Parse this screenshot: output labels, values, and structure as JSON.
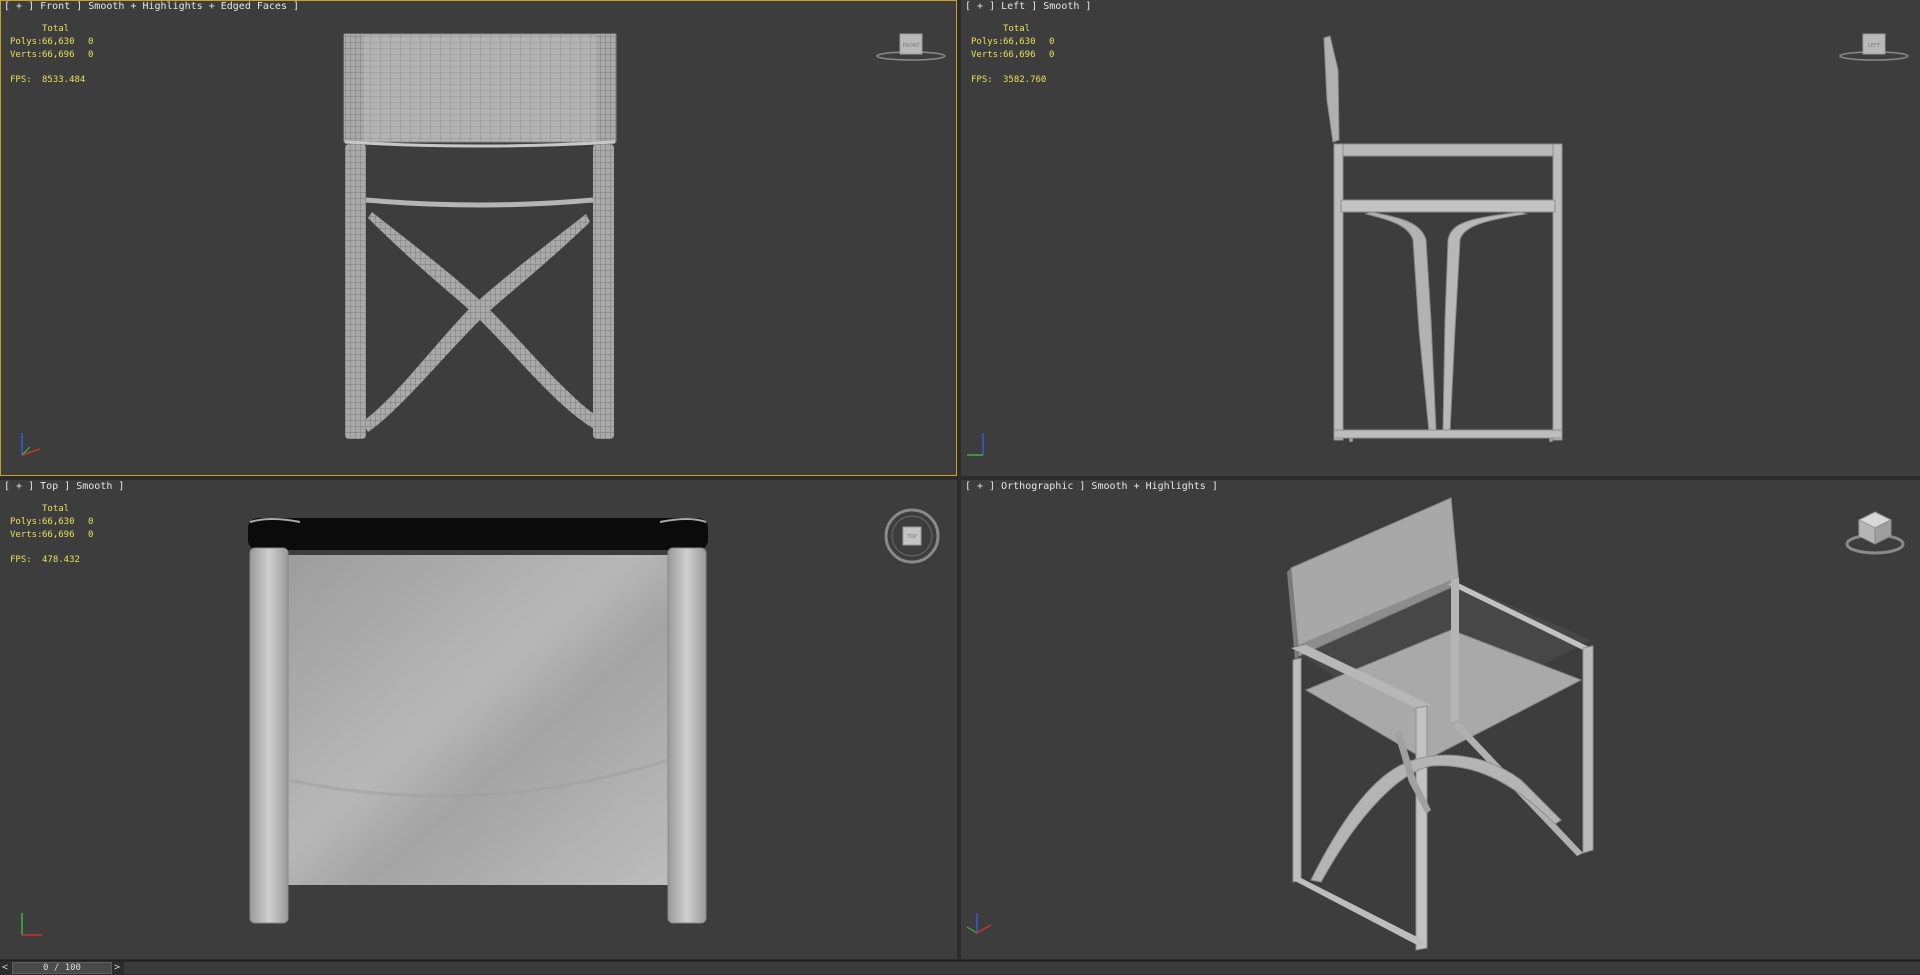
{
  "viewports": {
    "front": {
      "label": "[ + ] Front ] Smooth + Highlights + Edged Faces ]",
      "stats": {
        "header": "Total",
        "polys_label": "Polys:",
        "polys_value": "66,630",
        "polys_sel": "0",
        "verts_label": "Verts:",
        "verts_value": "66,696",
        "verts_sel": "0",
        "fps_label": "FPS:",
        "fps_value": "8533.484"
      },
      "navcube": "FRONT"
    },
    "left": {
      "label": "[ + ] Left ] Smooth ]",
      "stats": {
        "header": "Total",
        "polys_label": "Polys:",
        "polys_value": "66,630",
        "polys_sel": "0",
        "verts_label": "Verts:",
        "verts_value": "66,696",
        "verts_sel": "0",
        "fps_label": "FPS:",
        "fps_value": "3582.760"
      },
      "navcube": "LEFT"
    },
    "top": {
      "label": "[ + ] Top ] Smooth ]",
      "stats": {
        "header": "Total",
        "polys_label": "Polys:",
        "polys_value": "66,630",
        "polys_sel": "0",
        "verts_label": "Verts:",
        "verts_value": "66,696",
        "verts_sel": "0",
        "fps_label": "FPS:",
        "fps_value": "478.432"
      },
      "navcube": "TOP"
    },
    "ortho": {
      "label": "[ + ] Orthographic ] Smooth + Highlights ]"
    }
  },
  "timeline": {
    "prev": "<",
    "frame": "0 / 100",
    "next": ">"
  },
  "colors": {
    "viewport_bg": "#3d3d3d",
    "active_border": "#c9a227",
    "stats_text": "#e8e05a",
    "axis_x": "#c83232",
    "axis_y": "#3cb43c",
    "axis_z": "#3c5ad2"
  },
  "icons": {
    "navcube": "view-cube-icon",
    "axis": "axis-tripod-icon",
    "prev": "chevron-left-icon",
    "next": "chevron-right-icon"
  }
}
